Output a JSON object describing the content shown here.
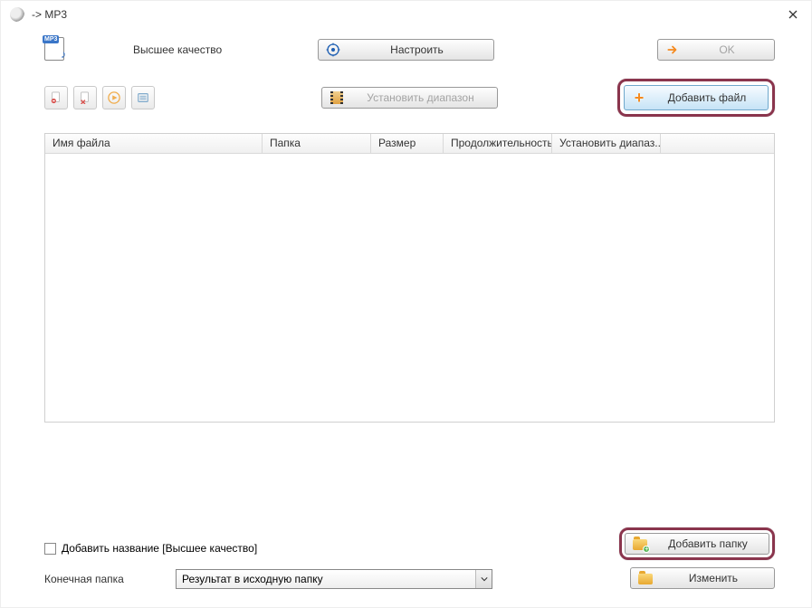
{
  "titlebar": {
    "title": "-> MP3"
  },
  "top": {
    "format_tag": "MP3",
    "quality_label": "Высшее качество",
    "configure_button": "Настроить",
    "ok_button": "OK"
  },
  "toolbar": {
    "set_range_button": "Установить диапазон",
    "add_file_button": "Добавить файл"
  },
  "table": {
    "columns": {
      "filename": "Имя файла",
      "folder": "Папка",
      "size": "Размер",
      "duration": "Продолжительность",
      "range": "Установить диапаз..."
    }
  },
  "bottom": {
    "add_title_checkbox": "Добавить название [Высшее качество]",
    "dest_folder_label": "Конечная папка",
    "dest_folder_value": "Результат в исходную папку",
    "add_folder_button": "Добавить папку",
    "change_button": "Изменить"
  }
}
